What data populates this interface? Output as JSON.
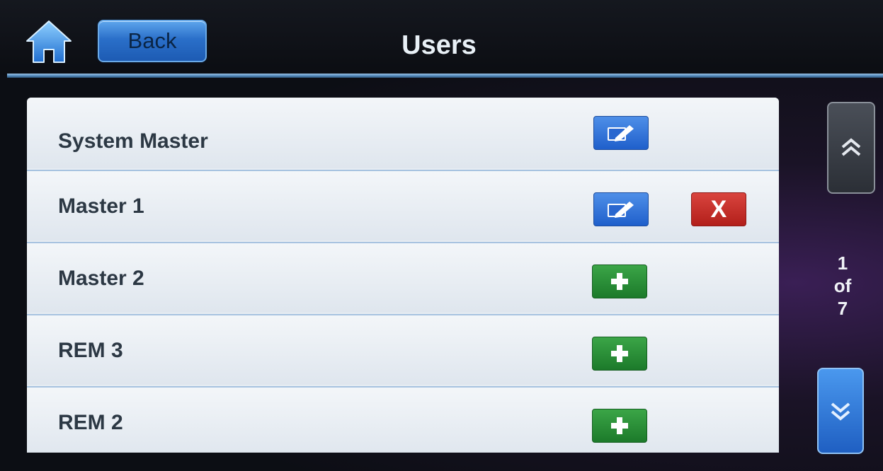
{
  "header": {
    "back_label": "Back",
    "title": "Users",
    "home_icon": "home-icon"
  },
  "users": [
    {
      "name": "System Master",
      "actions": [
        "edit"
      ]
    },
    {
      "name": "Master 1",
      "actions": [
        "edit",
        "delete"
      ]
    },
    {
      "name": "Master 2",
      "actions": [
        "add"
      ]
    },
    {
      "name": "REM 3",
      "actions": [
        "add"
      ]
    },
    {
      "name": "REM 2",
      "actions": [
        "add"
      ]
    }
  ],
  "delete_glyph": "X",
  "pagination": {
    "current": "1",
    "of_label": "of",
    "total": "7"
  },
  "colors": {
    "accent_blue": "#2a6fc9",
    "delete_red": "#b21f1a",
    "add_green": "#1c7a2a",
    "list_bg": "#e6ecf2"
  }
}
